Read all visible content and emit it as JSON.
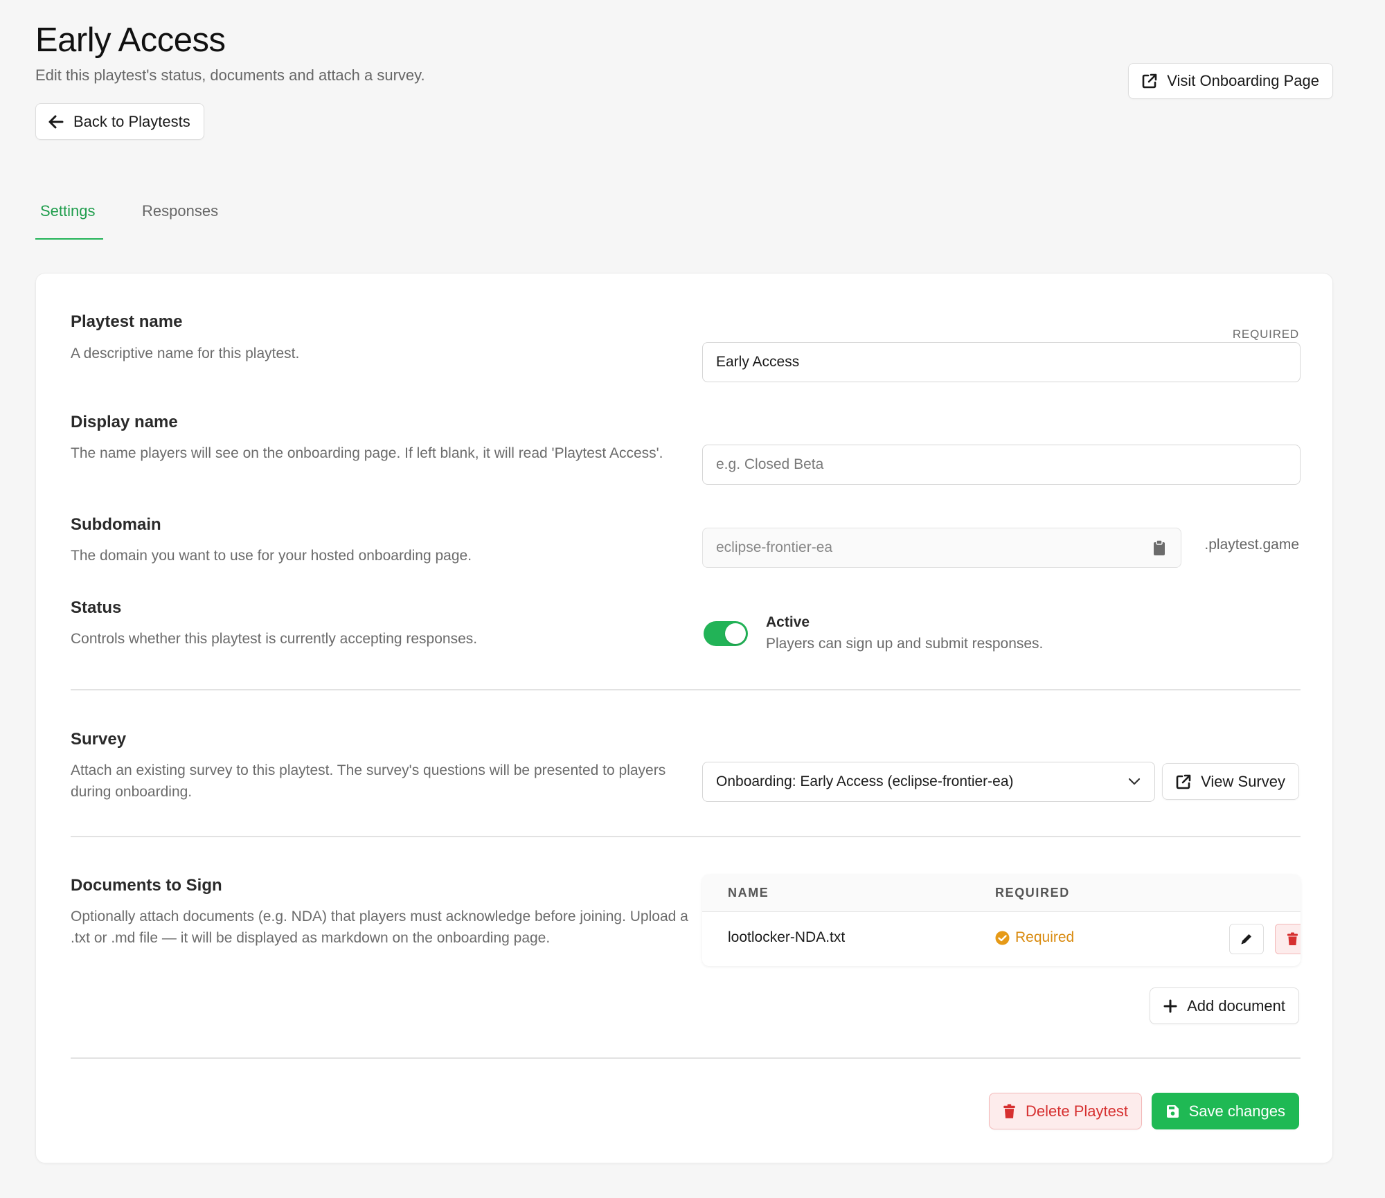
{
  "header": {
    "title": "Early Access",
    "subtitle": "Edit this playtest's status, documents and attach a survey.",
    "back_label": "Back to Playtests",
    "visit_label": "Visit Onboarding Page"
  },
  "tabs": [
    {
      "label": "Settings",
      "active": true
    },
    {
      "label": "Responses",
      "active": false
    }
  ],
  "fields": {
    "playtest_name": {
      "title": "Playtest name",
      "desc": "A descriptive name for this playtest.",
      "required_tag": "REQUIRED",
      "value": "Early Access"
    },
    "display_name": {
      "title": "Display name",
      "desc": "The name players will see on the onboarding page. If left blank, it will read 'Playtest Access'.",
      "placeholder": "e.g. Closed Beta",
      "value": ""
    },
    "subdomain": {
      "title": "Subdomain",
      "desc": "The domain you want to use for your hosted onboarding page.",
      "value": "eclipse-frontier-ea",
      "suffix": ".playtest.game"
    },
    "status": {
      "title": "Status",
      "desc": "Controls whether this playtest is currently accepting responses.",
      "toggle_on": true,
      "label": "Active",
      "detail": "Players can sign up and submit responses."
    }
  },
  "survey": {
    "title": "Survey",
    "desc": "Attach an existing survey to this playtest. The survey's questions will be presented to players during onboarding.",
    "selected": "Onboarding: Early Access (eclipse-frontier-ea)",
    "view_label": "View Survey"
  },
  "documents": {
    "title": "Documents to Sign",
    "desc": "Optionally attach documents (e.g. NDA) that players must acknowledge before joining. Upload a .txt or .md file — it will be displayed as markdown on the onboarding page.",
    "columns": [
      "NAME",
      "REQUIRED"
    ],
    "rows": [
      {
        "name": "lootlocker-NDA.txt",
        "required": "Required"
      }
    ],
    "add_label": "Add document"
  },
  "footer": {
    "delete_label": "Delete Playtest",
    "save_label": "Save changes"
  },
  "colors": {
    "accent": "#1fb954",
    "danger": "#d63030",
    "warning": "#d98b10"
  },
  "icons": [
    "arrow-left-icon",
    "external-link-icon",
    "clipboard-icon",
    "chevron-down-icon",
    "check-circle-icon",
    "pencil-icon",
    "trash-icon",
    "plus-icon",
    "save-icon"
  ]
}
